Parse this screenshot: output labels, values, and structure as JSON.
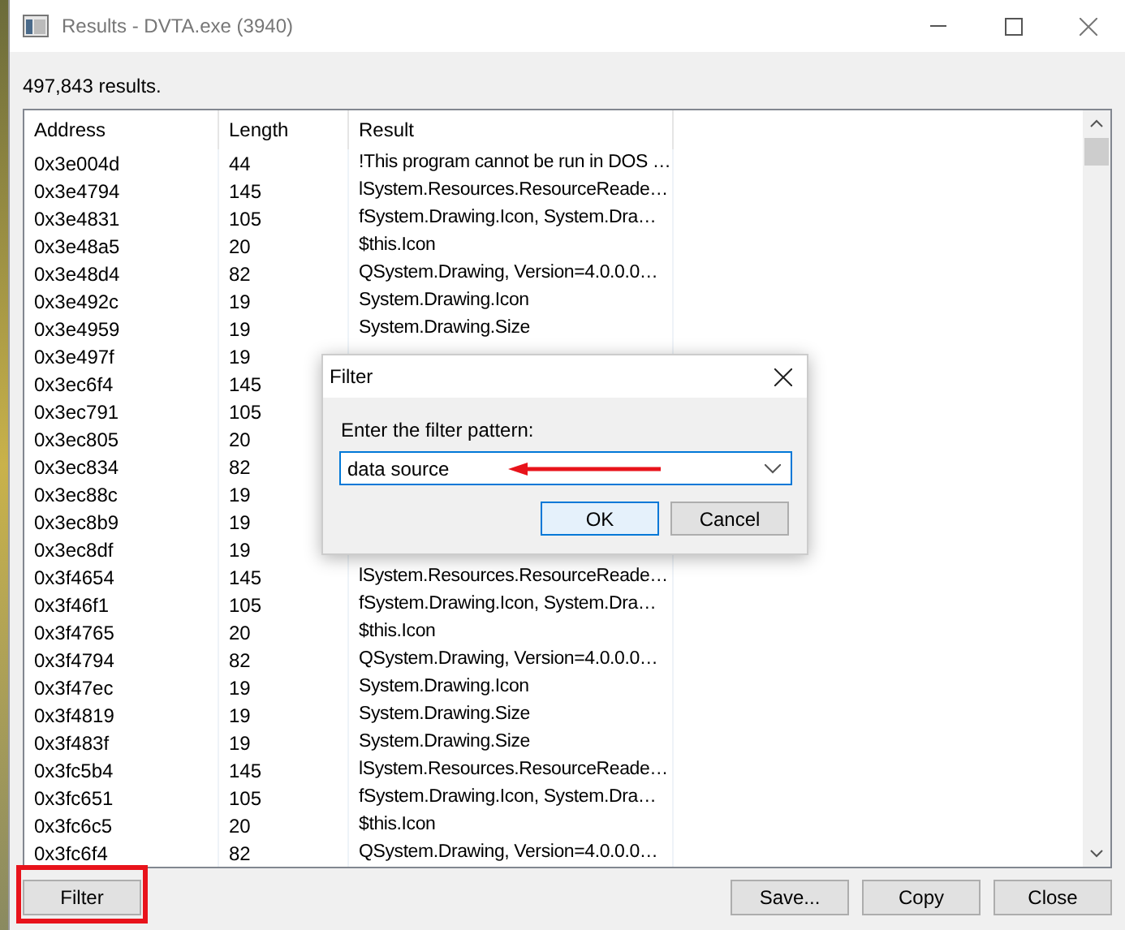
{
  "window": {
    "title": "Results - DVTA.exe (3940)"
  },
  "count": "497,843 results.",
  "table": {
    "columns": [
      "Address",
      "Length",
      "Result"
    ],
    "rows": [
      {
        "address": "0x3e004d",
        "length": "44",
        "result": "!This program cannot be run in DOS …"
      },
      {
        "address": "0x3e4794",
        "length": "145",
        "result": "lSystem.Resources.ResourceReade…"
      },
      {
        "address": "0x3e4831",
        "length": "105",
        "result": "fSystem.Drawing.Icon, System.Dra…"
      },
      {
        "address": "0x3e48a5",
        "length": "20",
        "result": "$this.Icon"
      },
      {
        "address": "0x3e48d4",
        "length": "82",
        "result": "QSystem.Drawing, Version=4.0.0.0…"
      },
      {
        "address": "0x3e492c",
        "length": "19",
        "result": "System.Drawing.Icon"
      },
      {
        "address": "0x3e4959",
        "length": "19",
        "result": "System.Drawing.Size"
      },
      {
        "address": "0x3e497f",
        "length": "19"
      },
      {
        "address": "0x3ec6f4",
        "length": "145"
      },
      {
        "address": "0x3ec791",
        "length": "105"
      },
      {
        "address": "0x3ec805",
        "length": "20"
      },
      {
        "address": "0x3ec834",
        "length": "82"
      },
      {
        "address": "0x3ec88c",
        "length": "19"
      },
      {
        "address": "0x3ec8b9",
        "length": "19"
      },
      {
        "address": "0x3ec8df",
        "length": "19"
      },
      {
        "address": "0x3f4654",
        "length": "145",
        "result": "lSystem.Resources.ResourceReade…"
      },
      {
        "address": "0x3f46f1",
        "length": "105",
        "result": "fSystem.Drawing.Icon, System.Dra…"
      },
      {
        "address": "0x3f4765",
        "length": "20",
        "result": "$this.Icon"
      },
      {
        "address": "0x3f4794",
        "length": "82",
        "result": "QSystem.Drawing, Version=4.0.0.0…"
      },
      {
        "address": "0x3f47ec",
        "length": "19",
        "result": "System.Drawing.Icon"
      },
      {
        "address": "0x3f4819",
        "length": "19",
        "result": "System.Drawing.Size"
      },
      {
        "address": "0x3f483f",
        "length": "19",
        "result": "System.Drawing.Size"
      },
      {
        "address": "0x3fc5b4",
        "length": "145",
        "result": "lSystem.Resources.ResourceReade…"
      },
      {
        "address": "0x3fc651",
        "length": "105",
        "result": "fSystem.Drawing.Icon, System.Dra…"
      },
      {
        "address": "0x3fc6c5",
        "length": "20",
        "result": "$this.Icon"
      },
      {
        "address": "0x3fc6f4",
        "length": "82",
        "result": "QSystem.Drawing, Version=4.0.0.0…"
      }
    ]
  },
  "buttons": [
    "Filter",
    "Save...",
    "Copy",
    "Close"
  ],
  "dialog": {
    "title": "Filter",
    "label": "Enter the filter pattern:",
    "value": "data source",
    "buttons": [
      {
        "label": "OK",
        "selected": true
      },
      {
        "label": "Cancel",
        "selected": false
      }
    ]
  }
}
